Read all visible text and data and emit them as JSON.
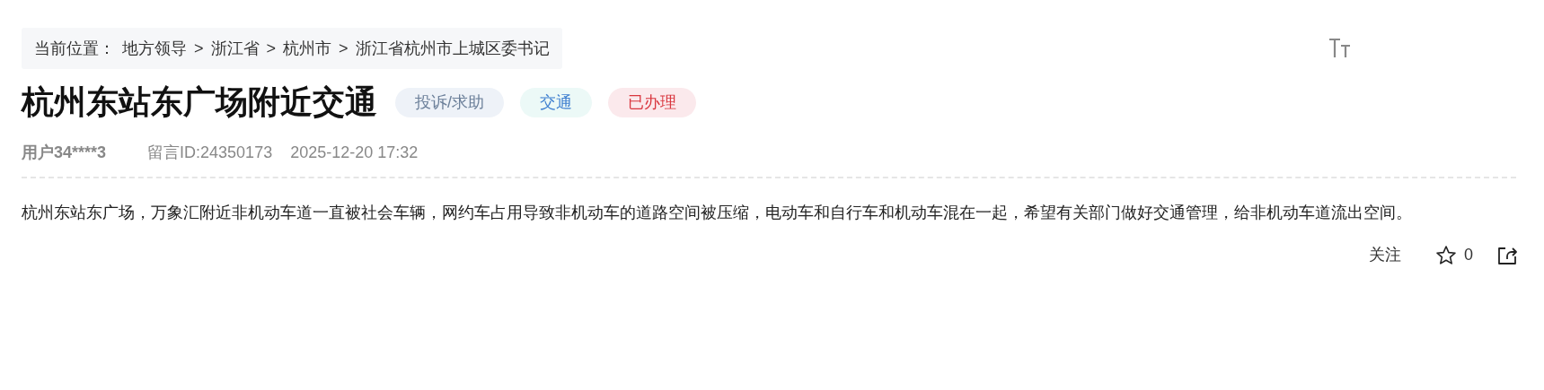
{
  "breadcrumb": {
    "label": "当前位置：",
    "separator": ">",
    "items": [
      "地方领导",
      "浙江省",
      "杭州市",
      "浙江省杭州市上城区委书记"
    ]
  },
  "title": "杭州东站东广场附近交通",
  "tags": [
    {
      "label": "投诉/求助",
      "color": "#6b7f99"
    },
    {
      "label": "交通",
      "color": "#3f7fd0"
    },
    {
      "label": "已办理",
      "color": "#d9363e"
    }
  ],
  "meta": {
    "user": "用户34****3",
    "message_id": "留言ID:24350173",
    "time": "2025-12-20 17:32"
  },
  "body": "杭州东站东广场，万象汇附近非机动车道一直被社会车辆，网约车占用导致非机动车的道路空间被压缩，电动车和自行车和机动车混在一起，希望有关部门做好交通管理，给非机动车道流出空间。",
  "actions": {
    "follow": "关注",
    "star_count": "0"
  }
}
